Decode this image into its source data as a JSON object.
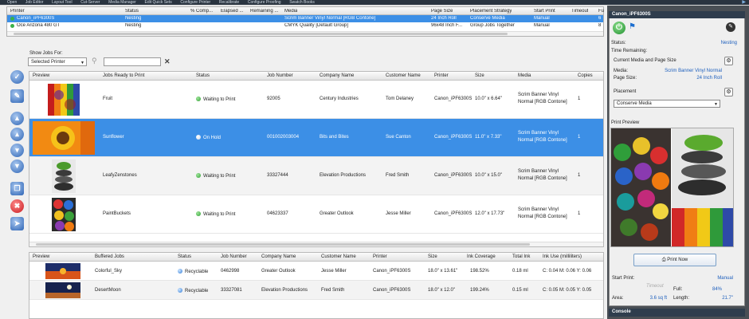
{
  "menubar": [
    "Open",
    "Job Editor",
    "Layout Tool",
    "Cut-Server",
    "Media Manager",
    "Edit Quick Sets",
    "Configure Printer",
    "Recalibrate",
    "Configure Proofing",
    "Swatch Books"
  ],
  "printers": {
    "columns": [
      "Printer",
      "Status",
      "% Comp...",
      "Elapsed ...",
      "Remaining ...",
      "Media",
      "Page Size",
      "Placement Strategy",
      "Start Print",
      "Timeout",
      "Fu"
    ],
    "rows": [
      {
        "printer": "Canon_iPF6300S",
        "status": "Nesting",
        "media": "Scrim Banner Vinyl Normal [RGB Contone]",
        "page_size": "24 Inch Roll",
        "placement": "Conserve Media",
        "start": "Manual",
        "timeout": "",
        "extra": "6"
      },
      {
        "printer": "Oce Arizona 480 GT",
        "status": "Nesting",
        "media": "CMYK Quality [Default Group]",
        "page_size": "96x48 Inch F...",
        "placement": "Group Jobs Together",
        "start": "Manual",
        "timeout": "",
        "extra": "8"
      }
    ]
  },
  "filter": {
    "label": "Show Jobs For:",
    "selected": "Selected Printer"
  },
  "ready": {
    "columns": [
      "Preview",
      "Jobs Ready to Print",
      "Status",
      "Job Number",
      "Company Name",
      "Customer Name",
      "Printer",
      "Size",
      "Media",
      "Copies"
    ],
    "rows": [
      {
        "name": "Fruit",
        "status": "Waiting to Print",
        "job": "92005",
        "company": "Century Industries",
        "customer": "Tom Delaney",
        "printer": "Canon_iPF6300S",
        "size": "10.0\" x 6.64\"",
        "media1": "Scrim Banner Vinyl",
        "media2": "Normal [RGB Contone]",
        "copies": "1"
      },
      {
        "name": "Sunflower",
        "status": "On Hold",
        "job": "001002003004",
        "company": "Bits and Bites",
        "customer": "Sue Canton",
        "printer": "Canon_iPF6300S",
        "size": "11.0\" x 7.33\"",
        "media1": "Scrim Banner Vinyl",
        "media2": "Normal [RGB Contone]",
        "copies": "1"
      },
      {
        "name": "LeafyZenstones",
        "status": "Waiting to Print",
        "job": "33327444",
        "company": "Elevation Productions",
        "customer": "Fred Smith",
        "printer": "Canon_iPF6300S",
        "size": "10.0\" x 15.0\"",
        "media1": "Scrim Banner Vinyl",
        "media2": "Normal [RGB Contone]",
        "copies": "1"
      },
      {
        "name": "PaintBuckets",
        "status": "Waiting to Print",
        "job": "04623337",
        "company": "Greater Outlook",
        "customer": "Jesse Miller",
        "printer": "Canon_iPF6300S",
        "size": "12.0\" x 17.73\"",
        "media1": "Scrim Banner Vinyl",
        "media2": "Normal [RGB Contone]",
        "copies": "1"
      }
    ]
  },
  "buffered": {
    "columns": [
      "Preview",
      "Buffered Jobs",
      "Status",
      "Job Number",
      "Company Name",
      "Customer Name",
      "Printer",
      "Size",
      "Ink Coverage",
      "Total Ink",
      "Ink Use (milliliters)"
    ],
    "rows": [
      {
        "name": "Colorful_Sky",
        "status": "Recyclable",
        "job": "0462998",
        "company": "Greater Outlook",
        "customer": "Jesse Miller",
        "printer": "Canon_iPF6300S",
        "size": "18.0\" x 13.61\"",
        "coverage": "198.52%",
        "total": "0.18 ml",
        "use": "C: 0.04 M: 0.06 Y: 0.06"
      },
      {
        "name": "DesertMoon",
        "status": "Recyclable",
        "job": "33327081",
        "company": "Elevation Productions",
        "customer": "Fred Smith",
        "printer": "Canon_iPF6300S",
        "size": "18.0\" x 12.0\"",
        "coverage": "199.24%",
        "total": "0.15 ml",
        "use": "C: 0.05 M: 0.05 Y: 0.05"
      }
    ]
  },
  "panel": {
    "title": "Canon_iPF6300S",
    "status_label": "Status:",
    "status_value": "Nesting",
    "time_label": "Time Remaining:",
    "media_section": "Current Media and Page Size",
    "media_label": "Media:",
    "media_value": "Scrim Banner Vinyl Normal",
    "page_label": "Page Size:",
    "page_value": "24 Inch Roll",
    "placement_section": "Placement",
    "placement_value": "Conserve Media",
    "preview_label": "Print Preview",
    "print_now": "Print Now",
    "start_label": "Start Print:",
    "start_value": "Manual",
    "timeout_label": "Timeout",
    "full_label": "Full:",
    "full_value": "84%",
    "area_label": "Area:",
    "area_value": "3.6 sq ft",
    "length_label": "Length:",
    "length_value": "21.7\"",
    "console": "Console"
  }
}
